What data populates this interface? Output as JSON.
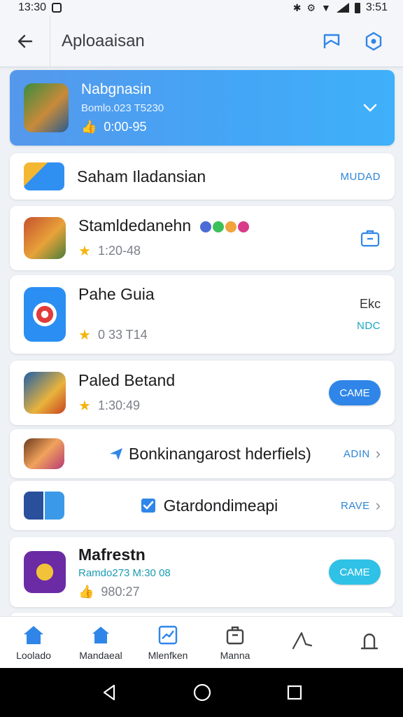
{
  "status_bar": {
    "time": "13:30",
    "right_time": "3:51"
  },
  "app_bar": {
    "title": "Aploaaisan"
  },
  "featured": {
    "name": "Nabgnasin",
    "subtitle": "Bomlo.023 T5230",
    "meta": "0:00-95"
  },
  "items": [
    {
      "name": "Saham Iladansian",
      "action": "MUDAD"
    },
    {
      "name": "Stamldedanehn",
      "meta": "1:20-48"
    },
    {
      "name": "Pahe Guia",
      "meta": "0 33 T14",
      "right_top": "Ekc",
      "right_bottom": "NDC"
    },
    {
      "name": "Paled Betand",
      "meta": "1:30:49",
      "button": "CAME"
    },
    {
      "name": "Bonkinangarost hderfiels)",
      "action": "ADIN"
    },
    {
      "name": "Gtardondimeapi",
      "action": "RAVE"
    },
    {
      "name": "Mafrestn",
      "subtitle": "Ramdo273 M:30 08",
      "meta": "980:27",
      "button": "CAME"
    }
  ],
  "bottom_nav": [
    {
      "label": "Loolado"
    },
    {
      "label": "Mandaeal"
    },
    {
      "label": "Mlenfken"
    },
    {
      "label": "Manna"
    },
    {
      "label": ""
    },
    {
      "label": ""
    }
  ],
  "colors": {
    "accent": "#2f86e8",
    "cyan": "#2fc1e6",
    "featured_start": "#5598ec",
    "featured_end": "#3fb0fa"
  }
}
